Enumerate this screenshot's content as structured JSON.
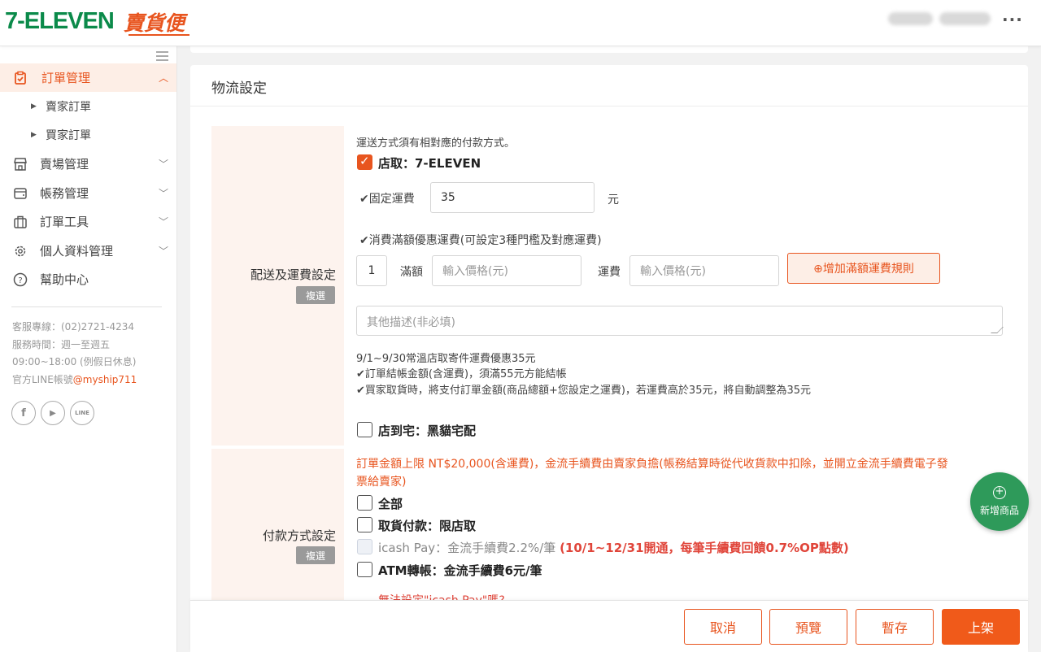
{
  "header": {
    "logo_711": "7-ELEVEN",
    "logo_service": "賣貨便",
    "menu_icon": "more-horizontal-icon"
  },
  "sidebar": {
    "items": [
      {
        "label": "訂單管理",
        "icon": "clipboard-check-icon"
      },
      {
        "label": "賣場管理",
        "icon": "store-icon"
      },
      {
        "label": "帳務管理",
        "icon": "wallet-icon"
      },
      {
        "label": "訂單工具",
        "icon": "briefcase-icon"
      },
      {
        "label": "個人資料管理",
        "icon": "gear-icon"
      },
      {
        "label": "幫助中心",
        "icon": "help-circle-icon"
      }
    ],
    "sub_items": [
      "賣家訂單",
      "買家訂單"
    ],
    "contact": {
      "hotline": "客服專線：(02)2721-4234",
      "hours": "服務時間：週一至週五",
      "time": "09:00~18:00 (例假日休息)",
      "line_prefix": "官方LINE帳號",
      "line_id": "@myship711"
    },
    "social": {
      "facebook": "f",
      "youtube": "▶",
      "line": "LINE"
    }
  },
  "main": {
    "section_title": "物流設定",
    "shipping": {
      "label": "配送及運費設定",
      "tag": "複選",
      "note": "運送方式須有相對應的付款方式。",
      "option1": "店取：7-ELEVEN",
      "fixed_fee_label": "✔固定運費",
      "fixed_fee_value": "35",
      "currency": "元",
      "discount_label": "✔消費滿額優惠運費(可設定3種門檻及對應運費)",
      "tier_index": "1",
      "threshold_label": "滿額",
      "threshold_placeholder": "輸入價格(元)",
      "fee_label": "運費",
      "fee_placeholder": "輸入價格(元)",
      "add_rule_button": "⊕增加滿額運費規則",
      "desc_placeholder": "其他描述(非必填)",
      "promo_lines": [
        "9/1~9/30常溫店取寄件運費優惠35元",
        "✔訂單結帳金額(含運費)，須滿55元方能結帳",
        "✔買家取貨時，將支付訂單金額(商品總額+您設定之運費)，若運費高於35元，將自動調整為35元"
      ],
      "option2": "店到宅：黑貓宅配"
    },
    "payment": {
      "label": "付款方式設定",
      "tag": "複選",
      "warning_line1": "訂單金額上限 NT$20,000(含運費)，金流手續費由賣家負擔(帳務結算時從代收貨款中扣除，並開立金流手續費電子發",
      "warning_line2": "票給賣家)",
      "opt_all": "全部",
      "opt_cod": "取貨付款：限店取",
      "opt_icash": "icash Pay：金流手續費2.2%/筆 ",
      "opt_icash_promo": "(10/1~12/31開通，每筆手續費回饋0.7%OP點數)",
      "opt_atm": "ATM轉帳：金流手續費6元/筆",
      "cutoff_text": "無法設定\"icash Pay\"嗎?"
    }
  },
  "actions": {
    "cancel": "取消",
    "preview": "預覽",
    "save_draft": "暫存",
    "publish": "上架"
  },
  "fab": {
    "label": "新增商品"
  },
  "colors": {
    "brand_orange": "#e8551f",
    "brand_green": "#0b8a4a",
    "fab_green": "#2e9a5a"
  }
}
